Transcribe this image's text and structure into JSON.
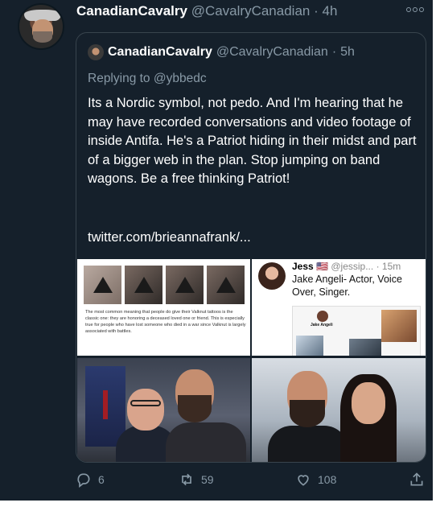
{
  "tweet": {
    "display_name": "CanadianCavalry",
    "handle": "@CavalryCanadian",
    "separator": "·",
    "time": "4h",
    "quoted": {
      "display_name": "CanadianCavalry",
      "handle": "@CavalryCanadian",
      "separator": "·",
      "time": "5h",
      "replying_to": "Replying to @ybbedc",
      "text": "Its a Nordic symbol, not pedo. And I'm hearing that he may have recorded conversations and video footage of inside Antifa. He's a Patriot hiding in their midst and part of a bigger web in the plan. Stop jumping on band wagons. Be a free thinking Patriot!",
      "link": "twitter.com/brieannafrank/...",
      "media": {
        "tattoo_caption": "The most common meaning that people do give their Valknut tattoos is the classic one: they are honoring a deceased loved one or friend. This is especially true for people who have lost someone who died in a war since Valknut is largely associated with battles.",
        "embedded_tweet": {
          "name": "Jess",
          "handle": "@jessip...",
          "time": "15m",
          "text": "Jake Angeli- Actor, Voice Over, Singer.",
          "card_name": "Jake Angeli"
        }
      }
    },
    "actions": {
      "replies": "6",
      "retweets": "59",
      "likes": "108"
    }
  },
  "colors": {
    "background": "#15202b",
    "secondary_text": "#8899a6",
    "border": "#38444d"
  },
  "icons": [
    "more-icon",
    "reply-icon",
    "retweet-icon",
    "like-icon",
    "share-icon",
    "flag-icon"
  ]
}
